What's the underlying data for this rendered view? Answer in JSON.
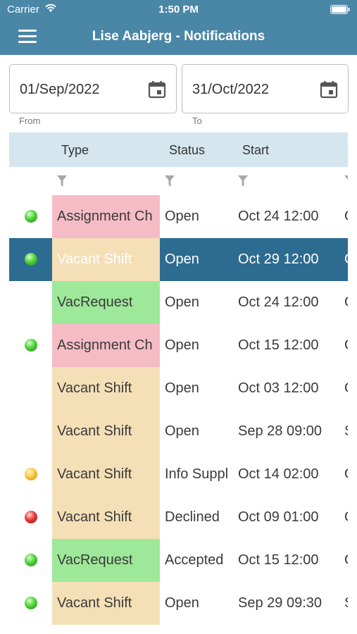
{
  "status_bar": {
    "carrier": "Carrier",
    "time": "1:50 PM"
  },
  "header": {
    "title": "Lise Aabjerg - Notifications"
  },
  "filters": {
    "from": {
      "value": "01/Sep/2022",
      "caption": "From"
    },
    "to": {
      "value": "31/Oct/2022",
      "caption": "To"
    }
  },
  "grid": {
    "columns": [
      "Type",
      "Status",
      "Start"
    ],
    "rows": [
      {
        "dot": "green",
        "type": "Assignment Ch",
        "type_color": "pink",
        "status": "Open",
        "start": "Oct 24 12:00",
        "extra": "O",
        "selected": false
      },
      {
        "dot": "green",
        "type": "Vacant Shift",
        "type_color": "orange",
        "status": "Open",
        "start": "Oct 29 12:00",
        "extra": "O",
        "selected": true
      },
      {
        "dot": "",
        "type": "VacRequest",
        "type_color": "green",
        "status": "Open",
        "start": "Oct 24 12:00",
        "extra": "O",
        "selected": false
      },
      {
        "dot": "green",
        "type": "Assignment Ch",
        "type_color": "pink",
        "status": "Open",
        "start": "Oct 15 12:00",
        "extra": "O",
        "selected": false
      },
      {
        "dot": "",
        "type": "Vacant Shift",
        "type_color": "orange",
        "status": "Open",
        "start": "Oct 03 12:00",
        "extra": "O",
        "selected": false
      },
      {
        "dot": "",
        "type": "Vacant Shift",
        "type_color": "orange",
        "status": "Open",
        "start": "Sep 28 09:00",
        "extra": "S",
        "selected": false
      },
      {
        "dot": "yellow",
        "type": "Vacant Shift",
        "type_color": "orange",
        "status": "Info Suppl",
        "start": "Oct 14 02:00",
        "extra": "O",
        "selected": false
      },
      {
        "dot": "red",
        "type": "Vacant Shift",
        "type_color": "orange",
        "status": "Declined",
        "start": "Oct 09 01:00",
        "extra": "O",
        "selected": false
      },
      {
        "dot": "green",
        "type": "VacRequest",
        "type_color": "green",
        "status": "Accepted",
        "start": "Oct 15 12:00",
        "extra": "O",
        "selected": false
      },
      {
        "dot": "green",
        "type": "Vacant Shift",
        "type_color": "orange",
        "status": "Open",
        "start": "Sep 29 09:30",
        "extra": "S",
        "selected": false
      }
    ]
  },
  "icons": {
    "menu": "hamburger-menu-icon",
    "calendar": "calendar-icon",
    "filter": "filter-funnel-icon",
    "wifi": "wifi-icon",
    "battery": "battery-icon"
  }
}
